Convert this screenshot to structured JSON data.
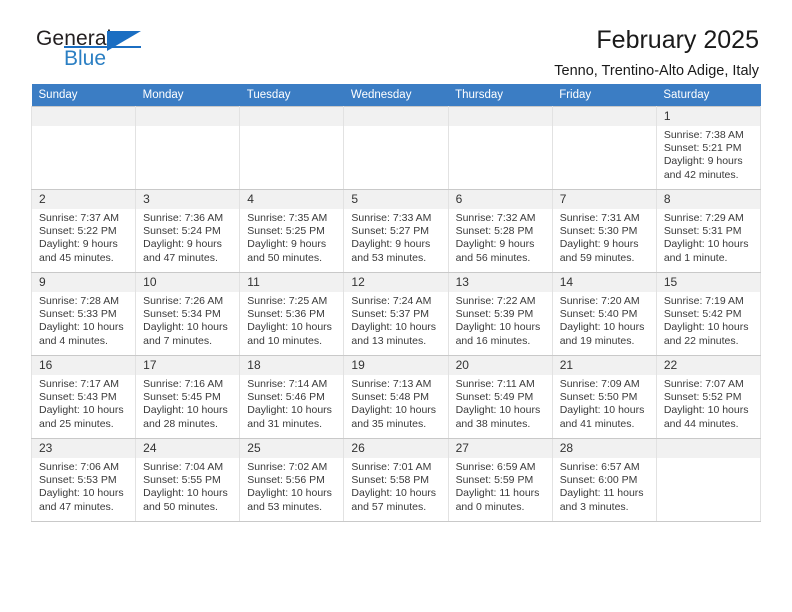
{
  "brand": {
    "name_top": "General",
    "name_bottom": "Blue",
    "accent_color": "#1b6ec2"
  },
  "header": {
    "title": "February 2025",
    "subtitle": "Tenno, Trentino-Alto Adige, Italy"
  },
  "calendar": {
    "header_background": "#3b7dc4",
    "weekday_headers": [
      "Sunday",
      "Monday",
      "Tuesday",
      "Wednesday",
      "Thursday",
      "Friday",
      "Saturday"
    ],
    "weeks": [
      [
        {
          "day": "",
          "empty": true
        },
        {
          "day": "",
          "empty": true
        },
        {
          "day": "",
          "empty": true
        },
        {
          "day": "",
          "empty": true
        },
        {
          "day": "",
          "empty": true
        },
        {
          "day": "",
          "empty": true
        },
        {
          "day": "1",
          "sunrise": "Sunrise: 7:38 AM",
          "sunset": "Sunset: 5:21 PM",
          "daylight_line1": "Daylight: 9 hours",
          "daylight_line2": "and 42 minutes."
        }
      ],
      [
        {
          "day": "2",
          "sunrise": "Sunrise: 7:37 AM",
          "sunset": "Sunset: 5:22 PM",
          "daylight_line1": "Daylight: 9 hours",
          "daylight_line2": "and 45 minutes."
        },
        {
          "day": "3",
          "sunrise": "Sunrise: 7:36 AM",
          "sunset": "Sunset: 5:24 PM",
          "daylight_line1": "Daylight: 9 hours",
          "daylight_line2": "and 47 minutes."
        },
        {
          "day": "4",
          "sunrise": "Sunrise: 7:35 AM",
          "sunset": "Sunset: 5:25 PM",
          "daylight_line1": "Daylight: 9 hours",
          "daylight_line2": "and 50 minutes."
        },
        {
          "day": "5",
          "sunrise": "Sunrise: 7:33 AM",
          "sunset": "Sunset: 5:27 PM",
          "daylight_line1": "Daylight: 9 hours",
          "daylight_line2": "and 53 minutes."
        },
        {
          "day": "6",
          "sunrise": "Sunrise: 7:32 AM",
          "sunset": "Sunset: 5:28 PM",
          "daylight_line1": "Daylight: 9 hours",
          "daylight_line2": "and 56 minutes."
        },
        {
          "day": "7",
          "sunrise": "Sunrise: 7:31 AM",
          "sunset": "Sunset: 5:30 PM",
          "daylight_line1": "Daylight: 9 hours",
          "daylight_line2": "and 59 minutes."
        },
        {
          "day": "8",
          "sunrise": "Sunrise: 7:29 AM",
          "sunset": "Sunset: 5:31 PM",
          "daylight_line1": "Daylight: 10 hours",
          "daylight_line2": "and 1 minute."
        }
      ],
      [
        {
          "day": "9",
          "sunrise": "Sunrise: 7:28 AM",
          "sunset": "Sunset: 5:33 PM",
          "daylight_line1": "Daylight: 10 hours",
          "daylight_line2": "and 4 minutes."
        },
        {
          "day": "10",
          "sunrise": "Sunrise: 7:26 AM",
          "sunset": "Sunset: 5:34 PM",
          "daylight_line1": "Daylight: 10 hours",
          "daylight_line2": "and 7 minutes."
        },
        {
          "day": "11",
          "sunrise": "Sunrise: 7:25 AM",
          "sunset": "Sunset: 5:36 PM",
          "daylight_line1": "Daylight: 10 hours",
          "daylight_line2": "and 10 minutes."
        },
        {
          "day": "12",
          "sunrise": "Sunrise: 7:24 AM",
          "sunset": "Sunset: 5:37 PM",
          "daylight_line1": "Daylight: 10 hours",
          "daylight_line2": "and 13 minutes."
        },
        {
          "day": "13",
          "sunrise": "Sunrise: 7:22 AM",
          "sunset": "Sunset: 5:39 PM",
          "daylight_line1": "Daylight: 10 hours",
          "daylight_line2": "and 16 minutes."
        },
        {
          "day": "14",
          "sunrise": "Sunrise: 7:20 AM",
          "sunset": "Sunset: 5:40 PM",
          "daylight_line1": "Daylight: 10 hours",
          "daylight_line2": "and 19 minutes."
        },
        {
          "day": "15",
          "sunrise": "Sunrise: 7:19 AM",
          "sunset": "Sunset: 5:42 PM",
          "daylight_line1": "Daylight: 10 hours",
          "daylight_line2": "and 22 minutes."
        }
      ],
      [
        {
          "day": "16",
          "sunrise": "Sunrise: 7:17 AM",
          "sunset": "Sunset: 5:43 PM",
          "daylight_line1": "Daylight: 10 hours",
          "daylight_line2": "and 25 minutes."
        },
        {
          "day": "17",
          "sunrise": "Sunrise: 7:16 AM",
          "sunset": "Sunset: 5:45 PM",
          "daylight_line1": "Daylight: 10 hours",
          "daylight_line2": "and 28 minutes."
        },
        {
          "day": "18",
          "sunrise": "Sunrise: 7:14 AM",
          "sunset": "Sunset: 5:46 PM",
          "daylight_line1": "Daylight: 10 hours",
          "daylight_line2": "and 31 minutes."
        },
        {
          "day": "19",
          "sunrise": "Sunrise: 7:13 AM",
          "sunset": "Sunset: 5:48 PM",
          "daylight_line1": "Daylight: 10 hours",
          "daylight_line2": "and 35 minutes."
        },
        {
          "day": "20",
          "sunrise": "Sunrise: 7:11 AM",
          "sunset": "Sunset: 5:49 PM",
          "daylight_line1": "Daylight: 10 hours",
          "daylight_line2": "and 38 minutes."
        },
        {
          "day": "21",
          "sunrise": "Sunrise: 7:09 AM",
          "sunset": "Sunset: 5:50 PM",
          "daylight_line1": "Daylight: 10 hours",
          "daylight_line2": "and 41 minutes."
        },
        {
          "day": "22",
          "sunrise": "Sunrise: 7:07 AM",
          "sunset": "Sunset: 5:52 PM",
          "daylight_line1": "Daylight: 10 hours",
          "daylight_line2": "and 44 minutes."
        }
      ],
      [
        {
          "day": "23",
          "sunrise": "Sunrise: 7:06 AM",
          "sunset": "Sunset: 5:53 PM",
          "daylight_line1": "Daylight: 10 hours",
          "daylight_line2": "and 47 minutes."
        },
        {
          "day": "24",
          "sunrise": "Sunrise: 7:04 AM",
          "sunset": "Sunset: 5:55 PM",
          "daylight_line1": "Daylight: 10 hours",
          "daylight_line2": "and 50 minutes."
        },
        {
          "day": "25",
          "sunrise": "Sunrise: 7:02 AM",
          "sunset": "Sunset: 5:56 PM",
          "daylight_line1": "Daylight: 10 hours",
          "daylight_line2": "and 53 minutes."
        },
        {
          "day": "26",
          "sunrise": "Sunrise: 7:01 AM",
          "sunset": "Sunset: 5:58 PM",
          "daylight_line1": "Daylight: 10 hours",
          "daylight_line2": "and 57 minutes."
        },
        {
          "day": "27",
          "sunrise": "Sunrise: 6:59 AM",
          "sunset": "Sunset: 5:59 PM",
          "daylight_line1": "Daylight: 11 hours",
          "daylight_line2": "and 0 minutes."
        },
        {
          "day": "28",
          "sunrise": "Sunrise: 6:57 AM",
          "sunset": "Sunset: 6:00 PM",
          "daylight_line1": "Daylight: 11 hours",
          "daylight_line2": "and 3 minutes."
        },
        {
          "day": "",
          "empty": true
        }
      ]
    ]
  }
}
